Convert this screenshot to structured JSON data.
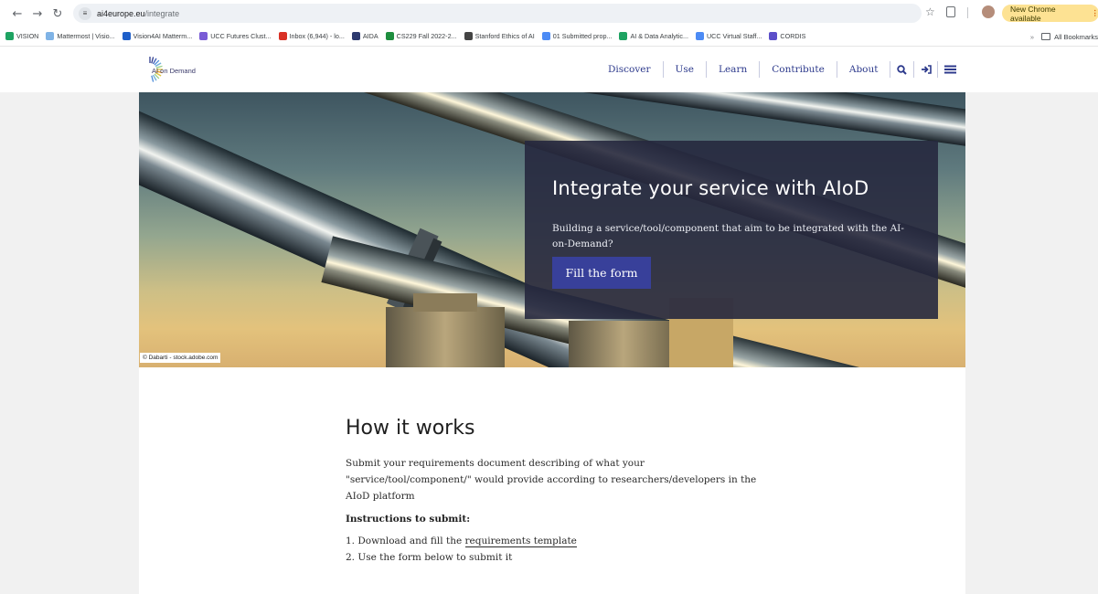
{
  "browser": {
    "url_host": "ai4europe.eu",
    "url_path": "/integrate",
    "update_label": "New Chrome available",
    "bookmarks": [
      {
        "label": "VISION",
        "color": "#1ea362"
      },
      {
        "label": "Mattermost | Visio...",
        "color": "#7fb3e6"
      },
      {
        "label": "Vision4AI Matterm...",
        "color": "#1e5fc9"
      },
      {
        "label": "UCC Futures Clust...",
        "color": "#7a5cd6"
      },
      {
        "label": "Inbox (6,944) - lo...",
        "color": "#d93025"
      },
      {
        "label": "AIDA",
        "color": "#2d3a6e"
      },
      {
        "label": "CS229 Fall 2022-2...",
        "color": "#1e8e3e"
      },
      {
        "label": "Stanford Ethics of AI",
        "color": "#444444"
      },
      {
        "label": "01 Submitted prop...",
        "color": "#4c8bf5"
      },
      {
        "label": "AI & Data Analytic...",
        "color": "#1ea362"
      },
      {
        "label": "UCC Virtual Staff...",
        "color": "#4c8bf5"
      },
      {
        "label": "CORDIS",
        "color": "#5c4fc9"
      }
    ],
    "bookmarks_overflow": "»",
    "all_bookmarks": "All Bookmarks"
  },
  "site": {
    "logo_text": "AI on Demand",
    "nav": [
      "Discover",
      "Use",
      "Learn",
      "Contribute",
      "About"
    ],
    "accent": "#2d3a8c"
  },
  "hero": {
    "title": "Integrate your service with AIoD",
    "text": "Building a service/tool/component that aim to be integrated with the AI-on-Demand?",
    "button": "Fill the form",
    "credit": "© Dabarti - stock.adobe.com"
  },
  "how": {
    "title": "How it works",
    "description": "Submit your requirements document describing of what your \"service/tool/component/\" would provide according to researchers/developers in the AIoD platform",
    "instructions_heading": "Instructions to submit:",
    "step1_prefix": "1. Download and fill the ",
    "step1_link": "requirements template",
    "step2": "2. Use the form below to submit it"
  }
}
